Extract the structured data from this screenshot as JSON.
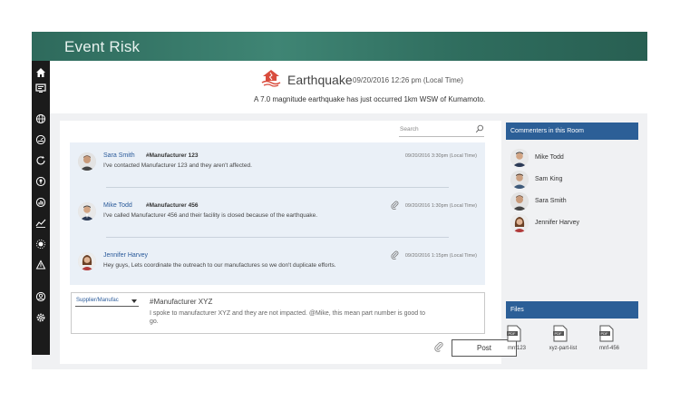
{
  "app": {
    "title": "Event Risk"
  },
  "event": {
    "icon": "earthquake-icon",
    "title": "Earthquake",
    "time": "09/20/2016 12:26 pm (Local Time)",
    "description": "A 7.0 magnitude earthquake has just occurred 1km WSW of Kumamoto."
  },
  "nav": {
    "icons": [
      "home-icon",
      "monitor-icon",
      "globe-icon",
      "speedometer-icon",
      "refresh-icon",
      "pin-icon",
      "chart-icon",
      "line-chart-icon",
      "sun-icon",
      "pitch-icon",
      "user-icon",
      "settings-icon"
    ]
  },
  "search": {
    "placeholder": "Search"
  },
  "messages": [
    {
      "name": "Sara Smith",
      "tag": "#Manufacturer 123",
      "text": "I've contacted Manufacturer 123 and they aren't affected.",
      "time": "09/20/2016 3:30pm (Local Time)",
      "attachment": false
    },
    {
      "name": "Mike Todd",
      "tag": "#Manufacturer 456",
      "text": "I've called Manufacturer 456 and their facility is closed because of the earthquake.",
      "time": "09/20/2016 1:30pm (Local Time)",
      "attachment": true
    },
    {
      "name": "Jennifer Harvey",
      "tag": "",
      "text": "Hey guys, Lets coordinate the outreach to our manufactures so we don't duplicate efforts.",
      "time": "09/20/2016 1:15pm (Local Time)",
      "attachment": true
    }
  ],
  "composer": {
    "dropdown_value": "Supplier/Manufac",
    "tag": "#Manufacturer XYZ",
    "body": "I spoke to manufacturer XYZ and they are not impacted. @Mike, this mean part number is good to go.",
    "post_label": "Post"
  },
  "commenters": {
    "heading": "Commenters in this Room",
    "people": [
      "Mike Todd",
      "Sam King",
      "Sara Smith",
      "Jennifer Harvey"
    ]
  },
  "files": {
    "heading": "Files",
    "items": [
      {
        "type": "PDF",
        "name": "mnf123"
      },
      {
        "type": "PDF",
        "name": "xyz-part-list"
      },
      {
        "type": "PDF",
        "name": "mnf-456"
      }
    ]
  },
  "colors": {
    "topbar": "#3f8574",
    "accent": "#2c5f97",
    "nav": "#1b1b1b"
  }
}
